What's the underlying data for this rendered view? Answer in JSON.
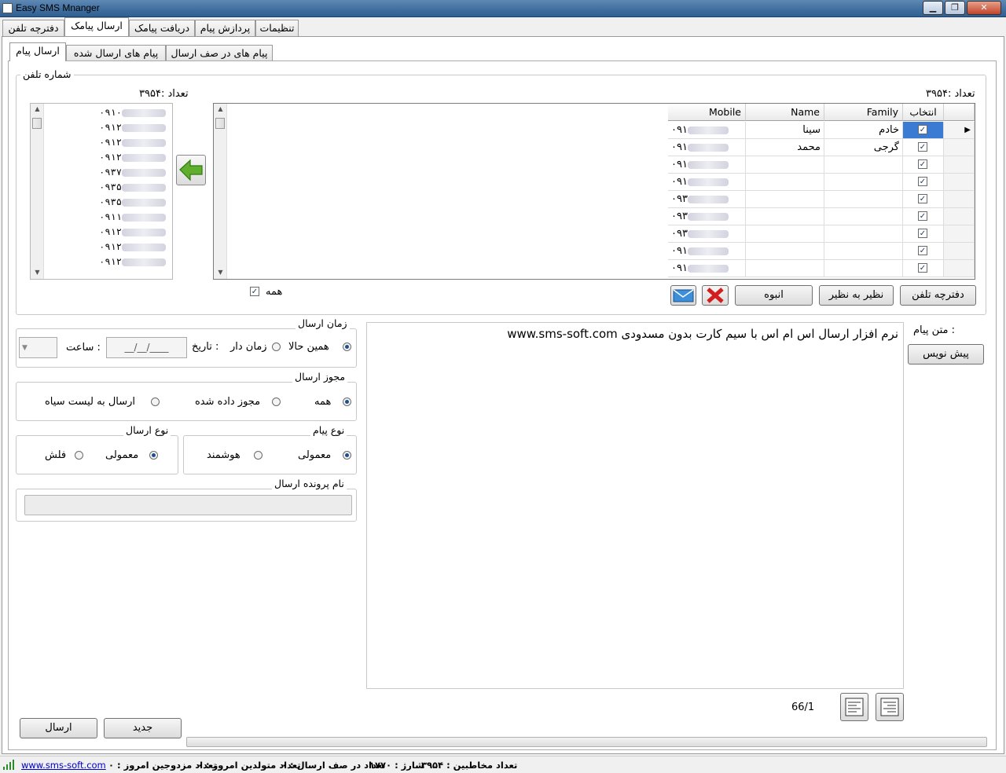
{
  "window": {
    "title": "Easy SMS Mnanger"
  },
  "main_tabs": [
    "تنظیمات",
    "پردازش پیام",
    "دریافت پیامک",
    "ارسال پیامک",
    "دفترچه تلفن"
  ],
  "sub_tabs": [
    "پیام های در صف ارسال",
    "پیام های ارسال شده",
    "ارسال پیام"
  ],
  "phone_group": {
    "title": "شماره تلفن",
    "right_count": "تعداد :۳۹۵۴",
    "left_count": "تعداد :۳۹۵۴",
    "numbers": [
      "۰۹۱۰",
      "۰۹۱۲",
      "۰۹۱۲",
      "۰۹۱۲",
      "۰۹۳۷",
      "۰۹۳۵",
      "۰۹۳۵",
      "۰۹۱۱",
      "۰۹۱۲",
      "۰۹۱۲",
      "۰۹۱۲"
    ],
    "all_label": "همه"
  },
  "grid": {
    "headers": {
      "select": "انتخاب",
      "family": "Family",
      "name": "Name",
      "mobile": "Mobile"
    },
    "rows": [
      {
        "family": "خادم",
        "name": "سینا",
        "mobile": "۰۹۱"
      },
      {
        "family": "گرجی",
        "name": "محمد",
        "mobile": "۰۹۱"
      },
      {
        "family": "",
        "name": "",
        "mobile": "۰۹۱"
      },
      {
        "family": "",
        "name": "",
        "mobile": "۰۹۱"
      },
      {
        "family": "",
        "name": "",
        "mobile": "۰۹۳"
      },
      {
        "family": "",
        "name": "",
        "mobile": "۰۹۳"
      },
      {
        "family": "",
        "name": "",
        "mobile": "۰۹۳"
      },
      {
        "family": "",
        "name": "",
        "mobile": "۰۹۱"
      },
      {
        "family": "",
        "name": "",
        "mobile": "۰۹۱"
      }
    ]
  },
  "buttons": {
    "phonebook": "دفترچه تلفن",
    "one_by_one": "نظیر به نظیر",
    "bulk": "انبوه",
    "presets": "پیش نویس",
    "send": "ارسال",
    "new": "جدید"
  },
  "send_time": {
    "title": "زمان ارسال",
    "now": "همین حالا",
    "scheduled": "زمان دار",
    "date_label": "تاریخ :",
    "date_value": "__/__/____",
    "time_label": "ساعت :"
  },
  "permission": {
    "title": "مجوز ارسال",
    "all": "همه",
    "allowed": "مجوز داده شده",
    "blacklist": "ارسال به لیست سیاه"
  },
  "message_type": {
    "title": "نوع پیام",
    "normal": "معمولی",
    "smart": "هوشمند"
  },
  "send_type": {
    "title": "نوع ارسال",
    "normal": "معمولی",
    "flash": "فلش"
  },
  "file_name": {
    "title": "نام پرونده ارسال"
  },
  "message": {
    "label": "متن پیام :",
    "text": "نرم افزار ارسال اس ام اس با سیم کارت بدون مسدودی www.sms-soft.com",
    "counter": "66/1"
  },
  "status": {
    "contacts": "تعداد مخاطبین : ۳۹۵۴",
    "charge": "شارژ : ۱۷۷۰",
    "queue": "تعداد در صف ارسال : ۰",
    "birthdays": "تعداد متولدین امروز : ۰",
    "married": "تعداد مزدوجین امروز : ۰",
    "site": "www.sms-soft.com"
  }
}
